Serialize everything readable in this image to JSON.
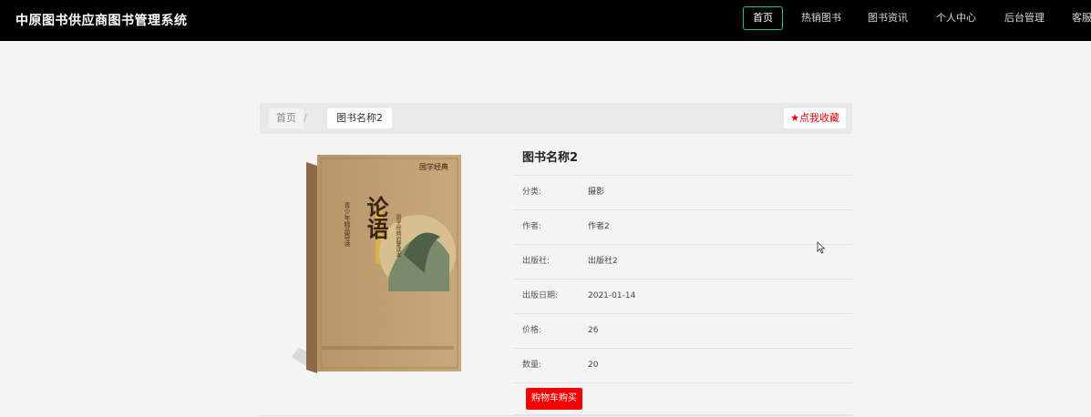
{
  "header": {
    "brand": "中原图书供应商图书管理系统",
    "nav": [
      {
        "label": "首页",
        "active": true
      },
      {
        "label": "热销图书",
        "active": false
      },
      {
        "label": "图书资讯",
        "active": false
      },
      {
        "label": "个人中心",
        "active": false
      },
      {
        "label": "后台管理",
        "active": false
      },
      {
        "label": "客服",
        "active": false
      }
    ]
  },
  "breadcrumb": {
    "home": "首页",
    "separator": "/",
    "current": "图书名称2",
    "favorite_label": "★点我收藏"
  },
  "book": {
    "name": "图书名称2",
    "cover_text": {
      "title": "论语",
      "brand": "国学经典",
      "subtitle": "国学经典启蒙读本",
      "series": "青少年精品导读"
    },
    "fields": [
      {
        "label": "分类:",
        "value": "摄影"
      },
      {
        "label": "作者:",
        "value": "作者2"
      },
      {
        "label": "出版社:",
        "value": "出版社2"
      },
      {
        "label": "出版日期:",
        "value": "2021-01-14"
      },
      {
        "label": "价格:",
        "value": "26"
      },
      {
        "label": "数量:",
        "value": "20"
      }
    ],
    "buy_label": "购物车购买"
  },
  "colors": {
    "topbar": "#000000",
    "active_nav_border": "#2fb39a",
    "buy_button": "#f30000",
    "favorite_text": "#e00000"
  }
}
